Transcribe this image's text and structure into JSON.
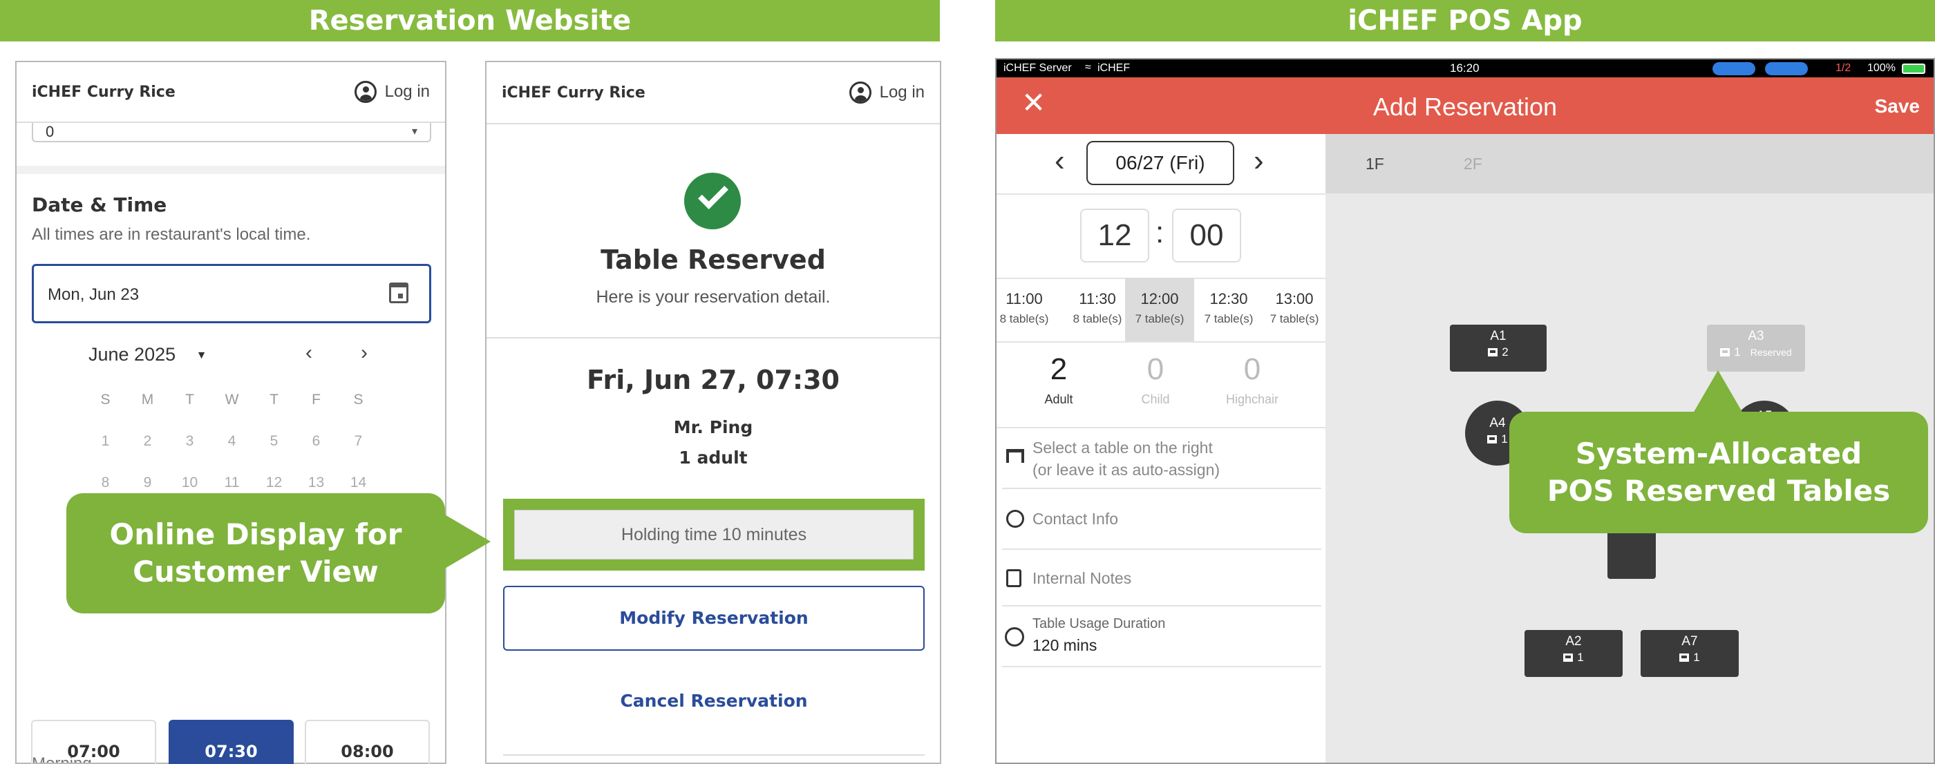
{
  "banners": {
    "left": "Reservation Website",
    "right": "iCHEF POS App"
  },
  "site_phone1": {
    "restaurant": "iCHEF Curry Rice",
    "login": "Log in",
    "select_value": "0",
    "date_time_heading": "Date & Time",
    "timezone_note": "All times are in restaurant's local time.",
    "date_input": "Mon, Jun 23",
    "month_label": "June 2025",
    "weekdays": [
      "S",
      "M",
      "T",
      "W",
      "T",
      "F",
      "S"
    ],
    "week1": [
      "1",
      "2",
      "3",
      "4",
      "5",
      "6",
      "7"
    ],
    "week2": [
      "8",
      "9",
      "10",
      "11",
      "12",
      "13",
      "14"
    ],
    "period_label": "Morning",
    "slots": [
      "07:00",
      "07:30",
      "08:00"
    ],
    "selected_slot": "07:30"
  },
  "site_phone2": {
    "restaurant": "iCHEF Curry Rice",
    "login": "Log in",
    "confirm_title": "Table Reserved",
    "confirm_sub": "Here is your reservation detail.",
    "reservation_datetime": "Fri, Jun 27, 07:30",
    "guest_name": "Mr. Ping",
    "party": "1 adult",
    "holding": "Holding time 10 minutes",
    "modify_btn": "Modify Reservation",
    "cancel_btn": "Cancel Reservation"
  },
  "callouts": {
    "online_line1": "Online Display for",
    "online_line2": "Customer View",
    "pos_line1": "System-Allocated",
    "pos_line2": "POS Reserved Tables"
  },
  "pos": {
    "status_left": "iCHEF Server",
    "status_wifi": "iCHEF",
    "time": "16:20",
    "status_pages": "1/2",
    "battery": "100%",
    "title": "Add Reservation",
    "save": "Save",
    "date": "06/27 (Fri)",
    "hour": "12",
    "minute": "00",
    "timeslots": [
      {
        "time": "11:00",
        "tables": "8 table(s)"
      },
      {
        "time": "11:30",
        "tables": "8 table(s)"
      },
      {
        "time": "12:00",
        "tables": "7 table(s)"
      },
      {
        "time": "12:30",
        "tables": "7 table(s)"
      },
      {
        "time": "13:00",
        "tables": "7 table(s)"
      }
    ],
    "guests": [
      {
        "count": "2",
        "label": "Adult"
      },
      {
        "count": "0",
        "label": "Child"
      },
      {
        "count": "0",
        "label": "Highchair"
      }
    ],
    "select_table_line1": "Select a table on the right",
    "select_table_line2": "(or leave it as auto-assign)",
    "contact_info": "Contact Info",
    "internal_notes": "Internal Notes",
    "usage_label": "Table Usage Duration",
    "usage_value": "120 mins",
    "floors": [
      "1F",
      "2F"
    ],
    "tables": {
      "a1": {
        "name": "A1",
        "seats": "2"
      },
      "a3": {
        "name": "A3",
        "seats": "1",
        "status": "Reserved"
      },
      "a4": {
        "name": "A4",
        "seats": "1"
      },
      "a5": {
        "name": "A5"
      },
      "a2": {
        "name": "A2",
        "seats": "1"
      },
      "a7": {
        "name": "A7",
        "seats": "1"
      }
    },
    "colors": {
      "header": "#e25a4b",
      "accent_green": "#86bb3f",
      "selected_blue": "#2a4c9a",
      "check_green": "#2e8b45"
    }
  }
}
